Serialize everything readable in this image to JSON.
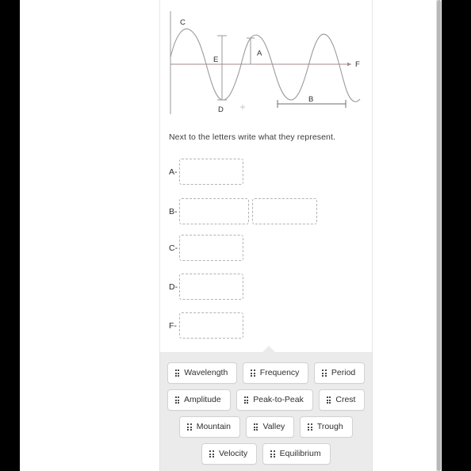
{
  "prompt": {
    "text": "Next to the letters write what they represent."
  },
  "figure": {
    "name": "wave-diagram",
    "axis_label": "F",
    "labels": [
      {
        "id": "C",
        "text": "C",
        "meaning": "crest-label"
      },
      {
        "id": "E",
        "text": "E",
        "meaning": "peak-to-peak-measure"
      },
      {
        "id": "A",
        "text": "A",
        "meaning": "amplitude-measure"
      },
      {
        "id": "D",
        "text": "D",
        "meaning": "trough-label"
      },
      {
        "id": "B",
        "text": "B",
        "meaning": "wavelength-measure"
      },
      {
        "id": "F",
        "text": "F",
        "meaning": "equilibrium-axis-label"
      }
    ],
    "curve_color": "#9a9a9a",
    "axis_color": "#a08a8a",
    "vertical_axis_color": "#9a9a9a"
  },
  "answers": {
    "rows": [
      {
        "letter": "A-",
        "slots": 1
      },
      {
        "letter": "B-",
        "slots": 2
      },
      {
        "letter": "C-",
        "slots": 1
      },
      {
        "letter": "D-",
        "slots": 1
      },
      {
        "letter": "F-",
        "slots": 1
      }
    ],
    "slot_placeholder": ""
  },
  "word_bank": {
    "rows": [
      [
        {
          "label": "Wavelength",
          "icon": "drag-handle-icon"
        },
        {
          "label": "Frequency",
          "icon": "drag-handle-icon"
        },
        {
          "label": "Period",
          "icon": "drag-handle-icon"
        }
      ],
      [
        {
          "label": "Amplitude",
          "icon": "drag-handle-icon"
        },
        {
          "label": "Peak-to-Peak",
          "icon": "drag-handle-icon"
        },
        {
          "label": "Crest",
          "icon": "drag-handle-icon"
        }
      ],
      [
        {
          "label": "Mountain",
          "icon": "drag-handle-icon"
        },
        {
          "label": "Valley",
          "icon": "drag-handle-icon"
        },
        {
          "label": "Trough",
          "icon": "drag-handle-icon"
        }
      ],
      [
        {
          "label": "Velocity",
          "icon": "drag-handle-icon"
        },
        {
          "label": "Equilibrium",
          "icon": "drag-handle-icon"
        }
      ]
    ],
    "background_color": "#ebebeb"
  },
  "colors": {
    "page_background": "#ffffff",
    "letterbox": "#000000",
    "card_border": "#e8e8e8",
    "slot_border": "#b4b4b4",
    "chip_border": "#d2d2d2",
    "text": "#3c3c3c"
  }
}
